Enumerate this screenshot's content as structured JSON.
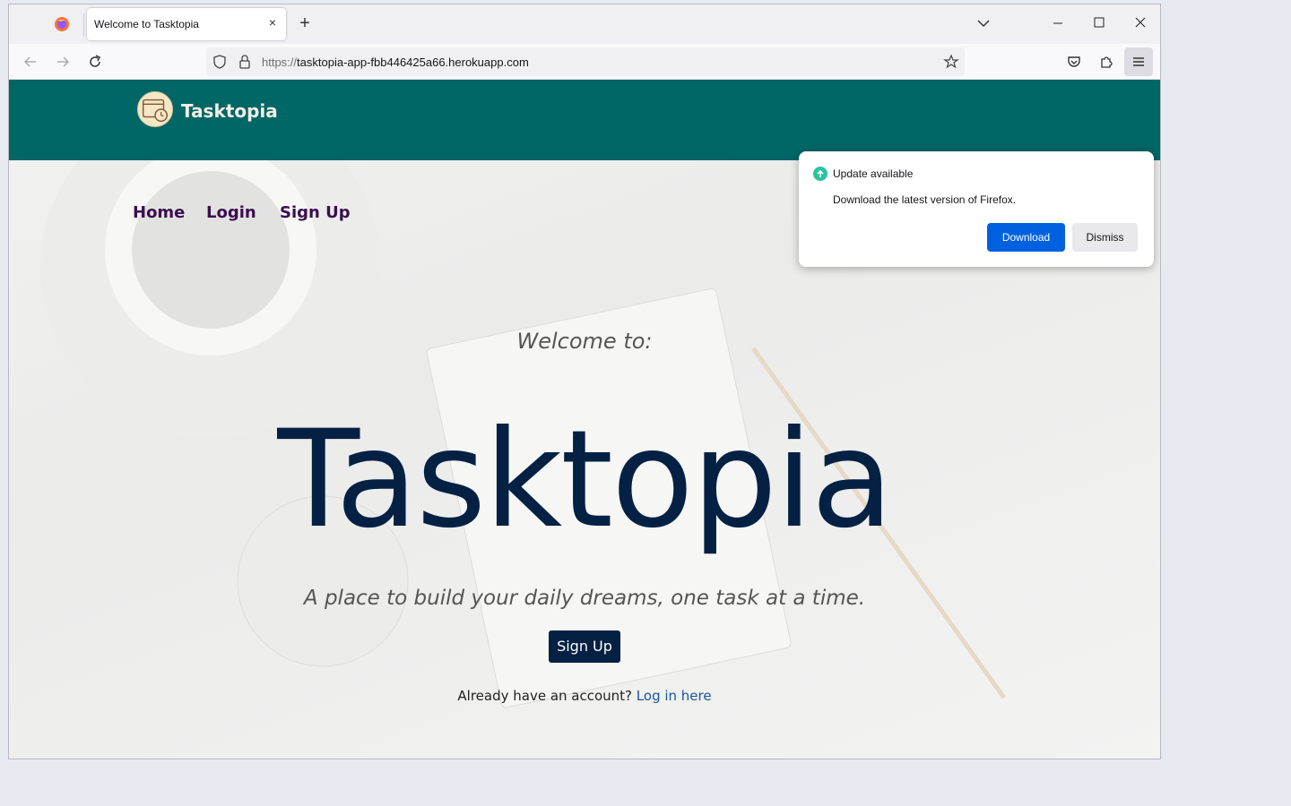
{
  "browser": {
    "tab_title": "Welcome to Tasktopia",
    "url_protocol": "https://",
    "url_host": "tasktopia-app-fbb446425a66.herokuapp.com"
  },
  "update_popup": {
    "title": "Update available",
    "message": "Download the latest version of Firefox.",
    "download_label": "Download",
    "dismiss_label": "Dismiss"
  },
  "site": {
    "brand": "Tasktopia",
    "nav": [
      "Home",
      "Login",
      "Sign Up"
    ],
    "welcome": "Welcome to:",
    "hero_title": "Tasktopia",
    "tagline": "A place to build your daily dreams, one task at a time.",
    "signup_label": "Sign Up",
    "login_prompt": "Already have an account?",
    "login_link": "Log in here"
  },
  "colors": {
    "header_bg": "#006666",
    "hero_text": "#042144",
    "nav_link": "#3b0f4f",
    "popup_button": "#0061e0"
  }
}
